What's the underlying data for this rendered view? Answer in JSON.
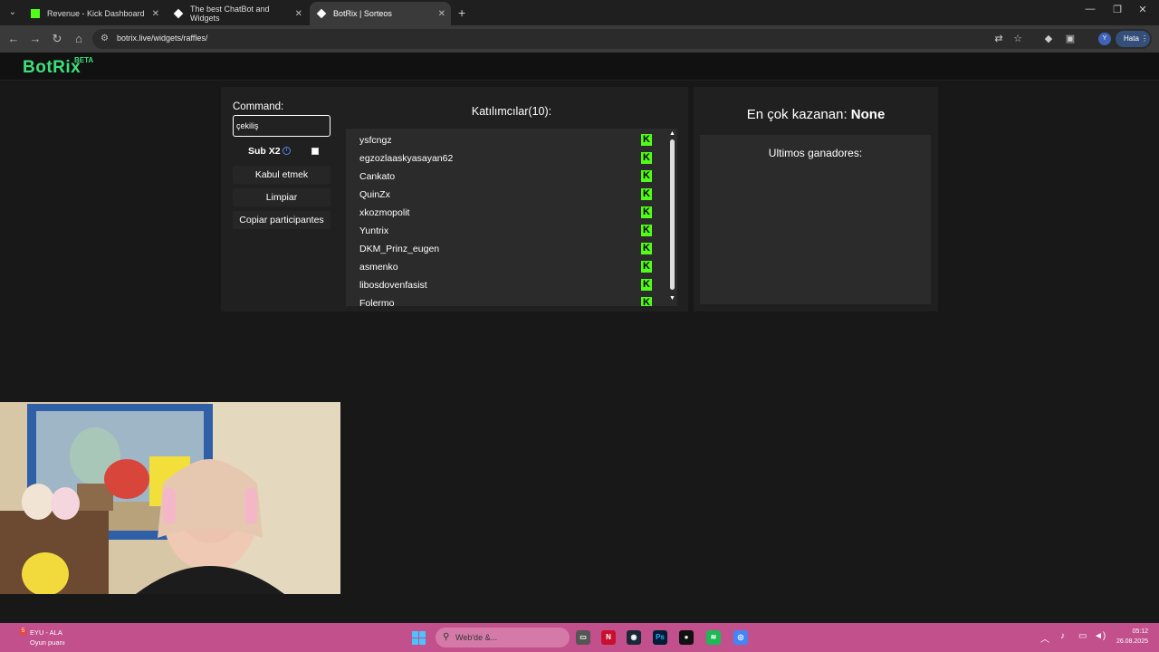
{
  "browser": {
    "tabs": [
      {
        "title": "Revenue - Kick Dashboard",
        "favicon": "kick-icon"
      },
      {
        "title": "The best ChatBot and Widgets",
        "favicon": "botrix-icon"
      },
      {
        "title": "BotRix | Sorteos",
        "favicon": "botrix-icon"
      }
    ],
    "url": "botrix.live/widgets/raffles/",
    "profile_initial": "Y",
    "error_label": "Hata"
  },
  "site": {
    "logo": "BotRix",
    "beta": "BETA"
  },
  "controls": {
    "command_label": "Command:",
    "command_value": "çekiliş",
    "sub_label": "Sub X2",
    "sub_checked": false,
    "accept_label": "Kabul etmek",
    "clear_label": "Limpiar",
    "copy_label": "Copiar participantes"
  },
  "participants": {
    "title": "Katılımcılar(10):",
    "items": [
      "ysfcngz",
      "egzozlaaskyasayan62",
      "Cankato",
      "QuinZx",
      "xkozmopolit",
      "Yuntrix",
      "DKM_Prinz_eugen",
      "asmenko",
      "libosdovenfasist",
      "Folermo"
    ]
  },
  "winners": {
    "top_label": "En çok kazanan:",
    "top_value": "None",
    "recent_label": "Ultimos ganadores:"
  },
  "taskbar": {
    "left_title": "EYU - ALA",
    "left_subtitle": "Oyun puanı",
    "search_placeholder": "Web'de &...",
    "time": "05:12",
    "date": "26.08.2025"
  },
  "colors": {
    "accent_green": "#3fe07a",
    "kick_green": "#53fc18",
    "taskbar": "#c1508c"
  }
}
